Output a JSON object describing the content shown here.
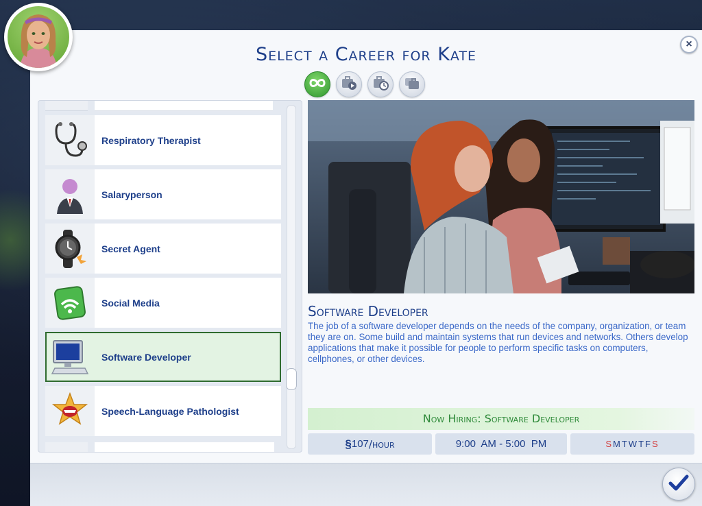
{
  "dialog": {
    "title": "Select a Career for Kate",
    "close_label": "×"
  },
  "filter_tabs": [
    {
      "name": "all-careers-tab",
      "icon": "infinity-icon",
      "active": true
    },
    {
      "name": "full-time-tab",
      "icon": "briefcase-play-icon",
      "active": false
    },
    {
      "name": "part-time-tab",
      "icon": "briefcase-clock-icon",
      "active": false
    },
    {
      "name": "freelance-tab",
      "icon": "briefcases-icon",
      "active": false
    }
  ],
  "careers": [
    {
      "label": "Respiratory Therapist",
      "icon": "stethoscope-icon",
      "selected": false
    },
    {
      "label": "Salaryperson",
      "icon": "suit-person-icon",
      "selected": false
    },
    {
      "label": "Secret Agent",
      "icon": "spy-watch-icon",
      "selected": false
    },
    {
      "label": "Social Media",
      "icon": "wifi-phone-icon",
      "selected": false
    },
    {
      "label": "Software Developer",
      "icon": "computer-icon",
      "selected": true
    },
    {
      "label": "Speech-Language Pathologist",
      "icon": "mouth-star-icon",
      "selected": false
    }
  ],
  "detail": {
    "title": "Software Developer",
    "description": "The job of a software developer depends on the needs of the company, organization, or team they are on. Some build and maintain systems that run devices and networks. Others develop applications that make it possible for people to perform specific tasks on computers, cellphones, or other devices.",
    "hiring": "Now Hiring: Software Developer",
    "pay_amount": "107",
    "pay_unit": "/hour",
    "pay_symbol": "§",
    "hours": "9:00  AM - 5:00  PM",
    "days": [
      "S",
      "M",
      "T",
      "W",
      "T",
      "F",
      "S"
    ],
    "weekend_color": "#d23a3a"
  },
  "colors": {
    "title": "#1e3f8a",
    "link_blue": "#3a68c8",
    "hiring_green": "#2f8a3a",
    "selection_border": "#2f6b2f"
  }
}
